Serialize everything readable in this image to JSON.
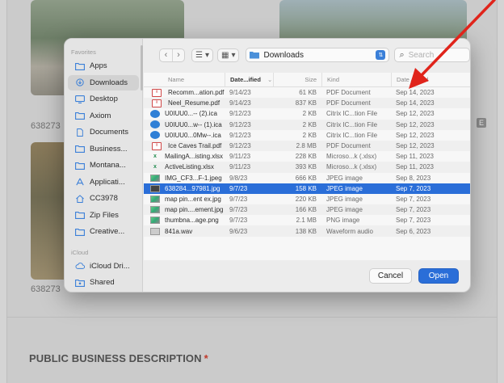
{
  "background": {
    "labels": {
      "left_top": "638273",
      "left_bottom": "638273",
      "chip_right": "E"
    },
    "section_title": "PUBLIC BUSINESS DESCRIPTION",
    "required_mark": "*"
  },
  "dialog": {
    "sidebar": {
      "favorites_heading": "Favorites",
      "items": [
        {
          "label": "Apps",
          "icon": "folder-icon"
        },
        {
          "label": "Downloads",
          "icon": "download-icon",
          "active": true
        },
        {
          "label": "Desktop",
          "icon": "desktop-icon"
        },
        {
          "label": "Axiom",
          "icon": "folder-icon"
        },
        {
          "label": "Documents",
          "icon": "document-icon"
        },
        {
          "label": "Business...",
          "icon": "folder-icon"
        },
        {
          "label": "Montana...",
          "icon": "folder-icon"
        },
        {
          "label": "Applicati...",
          "icon": "applications-icon"
        },
        {
          "label": "CC3978",
          "icon": "home-icon"
        },
        {
          "label": "Zip Files",
          "icon": "folder-icon"
        },
        {
          "label": "Creative...",
          "icon": "folder-icon"
        }
      ],
      "icloud_heading": "iCloud",
      "icloud_items": [
        {
          "label": "iCloud Dri...",
          "icon": "cloud-icon"
        },
        {
          "label": "Shared",
          "icon": "shared-folder-icon"
        }
      ]
    },
    "toolbar": {
      "back": "‹",
      "forward": "›",
      "location": "Downloads",
      "search_placeholder": "Search"
    },
    "columns": {
      "name": "Name",
      "date": "Date...ified",
      "size": "Size",
      "kind": "Kind",
      "added": "Date Added"
    },
    "files": [
      {
        "name": "Recomm...ation.pdf",
        "date": "9/14/23",
        "size": "61 KB",
        "kind": "PDF Document",
        "added": "Sep 14, 2023",
        "type": "pdf"
      },
      {
        "name": "Neel_Resume.pdf",
        "date": "9/14/23",
        "size": "837 KB",
        "kind": "PDF Document",
        "added": "Sep 14, 2023",
        "type": "pdf"
      },
      {
        "name": "U0IUU0...-- (2).ica",
        "date": "9/12/23",
        "size": "2 KB",
        "kind": "Citrix IC...tion File",
        "added": "Sep 12, 2023",
        "type": "ica"
      },
      {
        "name": "U0IUU0...w-- (1).ica",
        "date": "9/12/23",
        "size": "2 KB",
        "kind": "Citrix IC...tion File",
        "added": "Sep 12, 2023",
        "type": "ica"
      },
      {
        "name": "U0IUU0...0Mw--.ica",
        "date": "9/12/23",
        "size": "2 KB",
        "kind": "Citrix IC...tion File",
        "added": "Sep 12, 2023",
        "type": "ica"
      },
      {
        "name": "Ice Caves Trail.pdf",
        "date": "9/12/23",
        "size": "2.8 MB",
        "kind": "PDF Document",
        "added": "Sep 12, 2023",
        "type": "pdf"
      },
      {
        "name": "MailingA...isting.xlsx",
        "date": "9/11/23",
        "size": "228 KB",
        "kind": "Microso...k (.xlsx)",
        "added": "Sep 11, 2023",
        "type": "xlsx"
      },
      {
        "name": "ActiveListing.xlsx",
        "date": "9/11/23",
        "size": "393 KB",
        "kind": "Microso...k (.xlsx)",
        "added": "Sep 11, 2023",
        "type": "xlsx"
      },
      {
        "name": "IMG_CF3...F-1.jpeg",
        "date": "9/8/23",
        "size": "666 KB",
        "kind": "JPEG image",
        "added": "Sep 8, 2023",
        "type": "img"
      },
      {
        "name": "638284...97981.jpg",
        "date": "9/7/23",
        "size": "158 KB",
        "kind": "JPEG image",
        "added": "Sep 7, 2023",
        "type": "img-dark",
        "selected": true
      },
      {
        "name": "map pin...ent ex.jpg",
        "date": "9/7/23",
        "size": "220 KB",
        "kind": "JPEG image",
        "added": "Sep 7, 2023",
        "type": "img"
      },
      {
        "name": "map pin....ement.jpg",
        "date": "9/7/23",
        "size": "166 KB",
        "kind": "JPEG image",
        "added": "Sep 7, 2023",
        "type": "img"
      },
      {
        "name": "thumbna...age.png",
        "date": "9/7/23",
        "size": "2.1 MB",
        "kind": "PNG image",
        "added": "Sep 7, 2023",
        "type": "img"
      },
      {
        "name": "841a.wav",
        "date": "9/6/23",
        "size": "138 KB",
        "kind": "Waveform audio",
        "added": "Sep 6, 2023",
        "type": "wav"
      }
    ],
    "buttons": {
      "cancel": "Cancel",
      "open": "Open"
    }
  },
  "colors": {
    "accent": "#2a6ed8",
    "annotation_arrow": "#e0241b"
  }
}
